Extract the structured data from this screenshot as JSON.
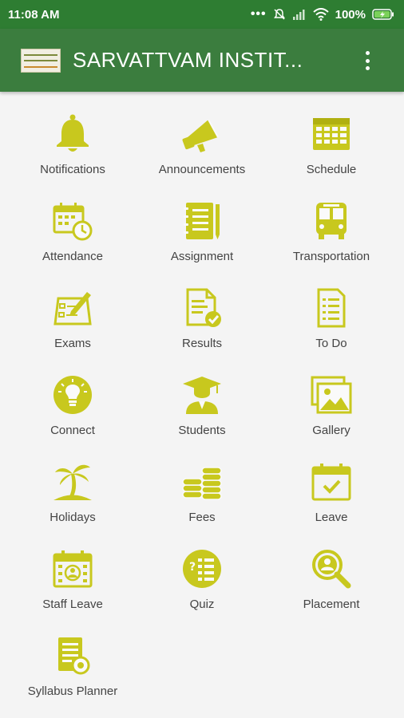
{
  "status": {
    "time": "11:08 AM",
    "battery": "100%"
  },
  "header": {
    "title": "SARVATTVAM INSTIT...",
    "menu_icon": "more-vert-icon"
  },
  "theme": {
    "primary": "#3b7d3e",
    "icon_color": "#c8c81e"
  },
  "menu": {
    "items": [
      {
        "label": "Notifications",
        "icon": "bell-icon"
      },
      {
        "label": "Announcements",
        "icon": "megaphone-icon"
      },
      {
        "label": "Schedule",
        "icon": "calendar-grid-icon"
      },
      {
        "label": "Attendance",
        "icon": "calendar-clock-icon"
      },
      {
        "label": "Assignment",
        "icon": "notebook-icon"
      },
      {
        "label": "Transportation",
        "icon": "bus-icon"
      },
      {
        "label": "Exams",
        "icon": "exam-sheet-icon"
      },
      {
        "label": "Results",
        "icon": "document-check-icon"
      },
      {
        "label": "To Do",
        "icon": "checklist-icon"
      },
      {
        "label": "Connect",
        "icon": "lightbulb-icon"
      },
      {
        "label": "Students",
        "icon": "graduate-icon"
      },
      {
        "label": "Gallery",
        "icon": "gallery-icon"
      },
      {
        "label": "Holidays",
        "icon": "palm-tree-icon"
      },
      {
        "label": "Fees",
        "icon": "coins-icon"
      },
      {
        "label": "Leave",
        "icon": "calendar-check-icon"
      },
      {
        "label": "Staff Leave",
        "icon": "calendar-person-icon"
      },
      {
        "label": "Quiz",
        "icon": "quiz-icon"
      },
      {
        "label": "Placement",
        "icon": "search-person-icon"
      },
      {
        "label": "Syllabus Planner",
        "icon": "planner-icon"
      }
    ]
  }
}
